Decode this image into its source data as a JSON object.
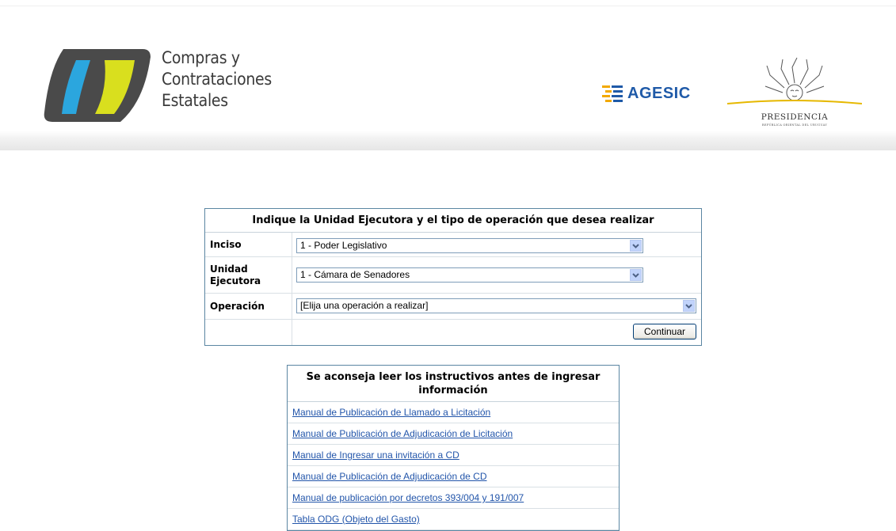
{
  "header": {
    "logo_lines": [
      "Compras y",
      "Contrataciones",
      "Estatales"
    ],
    "agesic_label": "AGESIC",
    "presidencia_label": "PRESIDENCIA",
    "presidencia_sub": "REPÚBLICA ORIENTAL DEL URUGUAY"
  },
  "form": {
    "title": "Indique la Unidad Ejecutora y el tipo de operación que desea realizar",
    "inciso_label": "Inciso",
    "inciso_value": "1 - Poder Legislativo",
    "unidad_label_1": "Unidad",
    "unidad_label_2": "Ejecutora",
    "unidad_value": "1 - Cámara de Senadores",
    "operacion_label": "Operación",
    "operacion_value": "[Elija una operación a realizar]",
    "continuar_label": "Continuar"
  },
  "manuals": {
    "title": "Se aconseja leer los instructivos antes de ingresar información",
    "items": [
      "Manual de Publicación de Llamado a Licitación",
      "Manual de Publicación de Adjudicación de Licitación",
      "Manual de Ingresar una invitación a CD",
      "Manual de Publicación de Adjudicación de CD",
      "Manual de publicación por decretos 393/004 y 191/007",
      "Tabla ODG (Objeto del Gasto)"
    ]
  },
  "colors": {
    "link": "#2255aa",
    "border": "#5b86a2",
    "agesic": "#1f5aa8"
  }
}
